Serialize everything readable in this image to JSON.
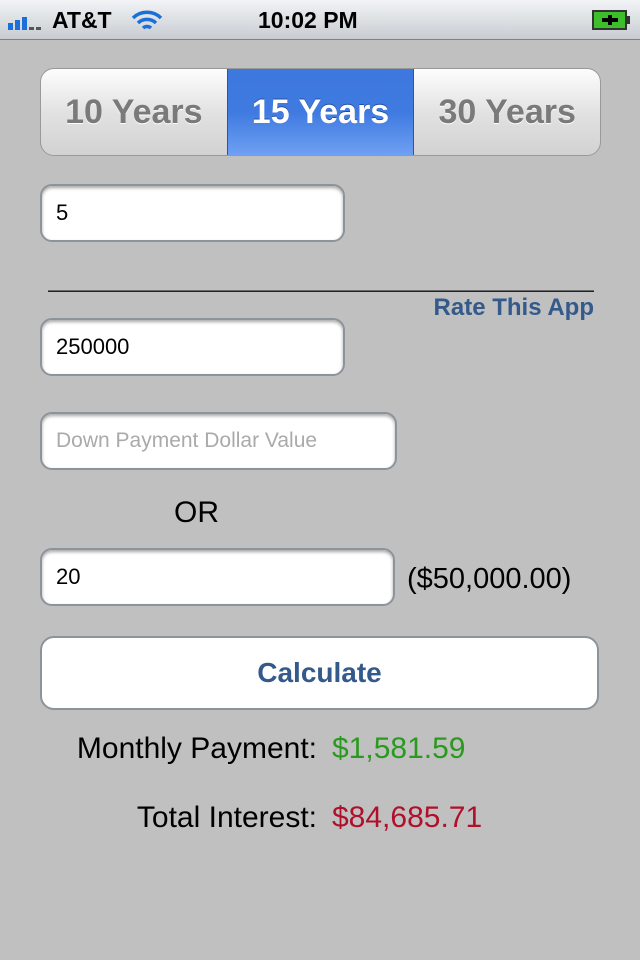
{
  "status": {
    "carrier": "AT&T",
    "time": "10:02 PM",
    "battery": "charging"
  },
  "segments": [
    {
      "label": "10 Years",
      "selected": false
    },
    {
      "label": "15 Years",
      "selected": true
    },
    {
      "label": "30 Years",
      "selected": false
    }
  ],
  "rate_value": "5",
  "divider": "________________________________________________",
  "rate_app": "Rate This App",
  "price_value": "250000",
  "down_payment_placeholder": "Down Payment Dollar Value",
  "or_label": "OR",
  "down_percent_value": "20",
  "down_amount": "($50,000.00)",
  "calculate_label": "Calculate",
  "monthly_label": "Monthly Payment:",
  "monthly_value": "$1,581.59",
  "interest_label": "Total Interest:",
  "interest_value": "$84,685.71",
  "colors": {
    "accent": "#345a8c",
    "monthly": "#2a9a1e",
    "interest": "#b0102a"
  }
}
